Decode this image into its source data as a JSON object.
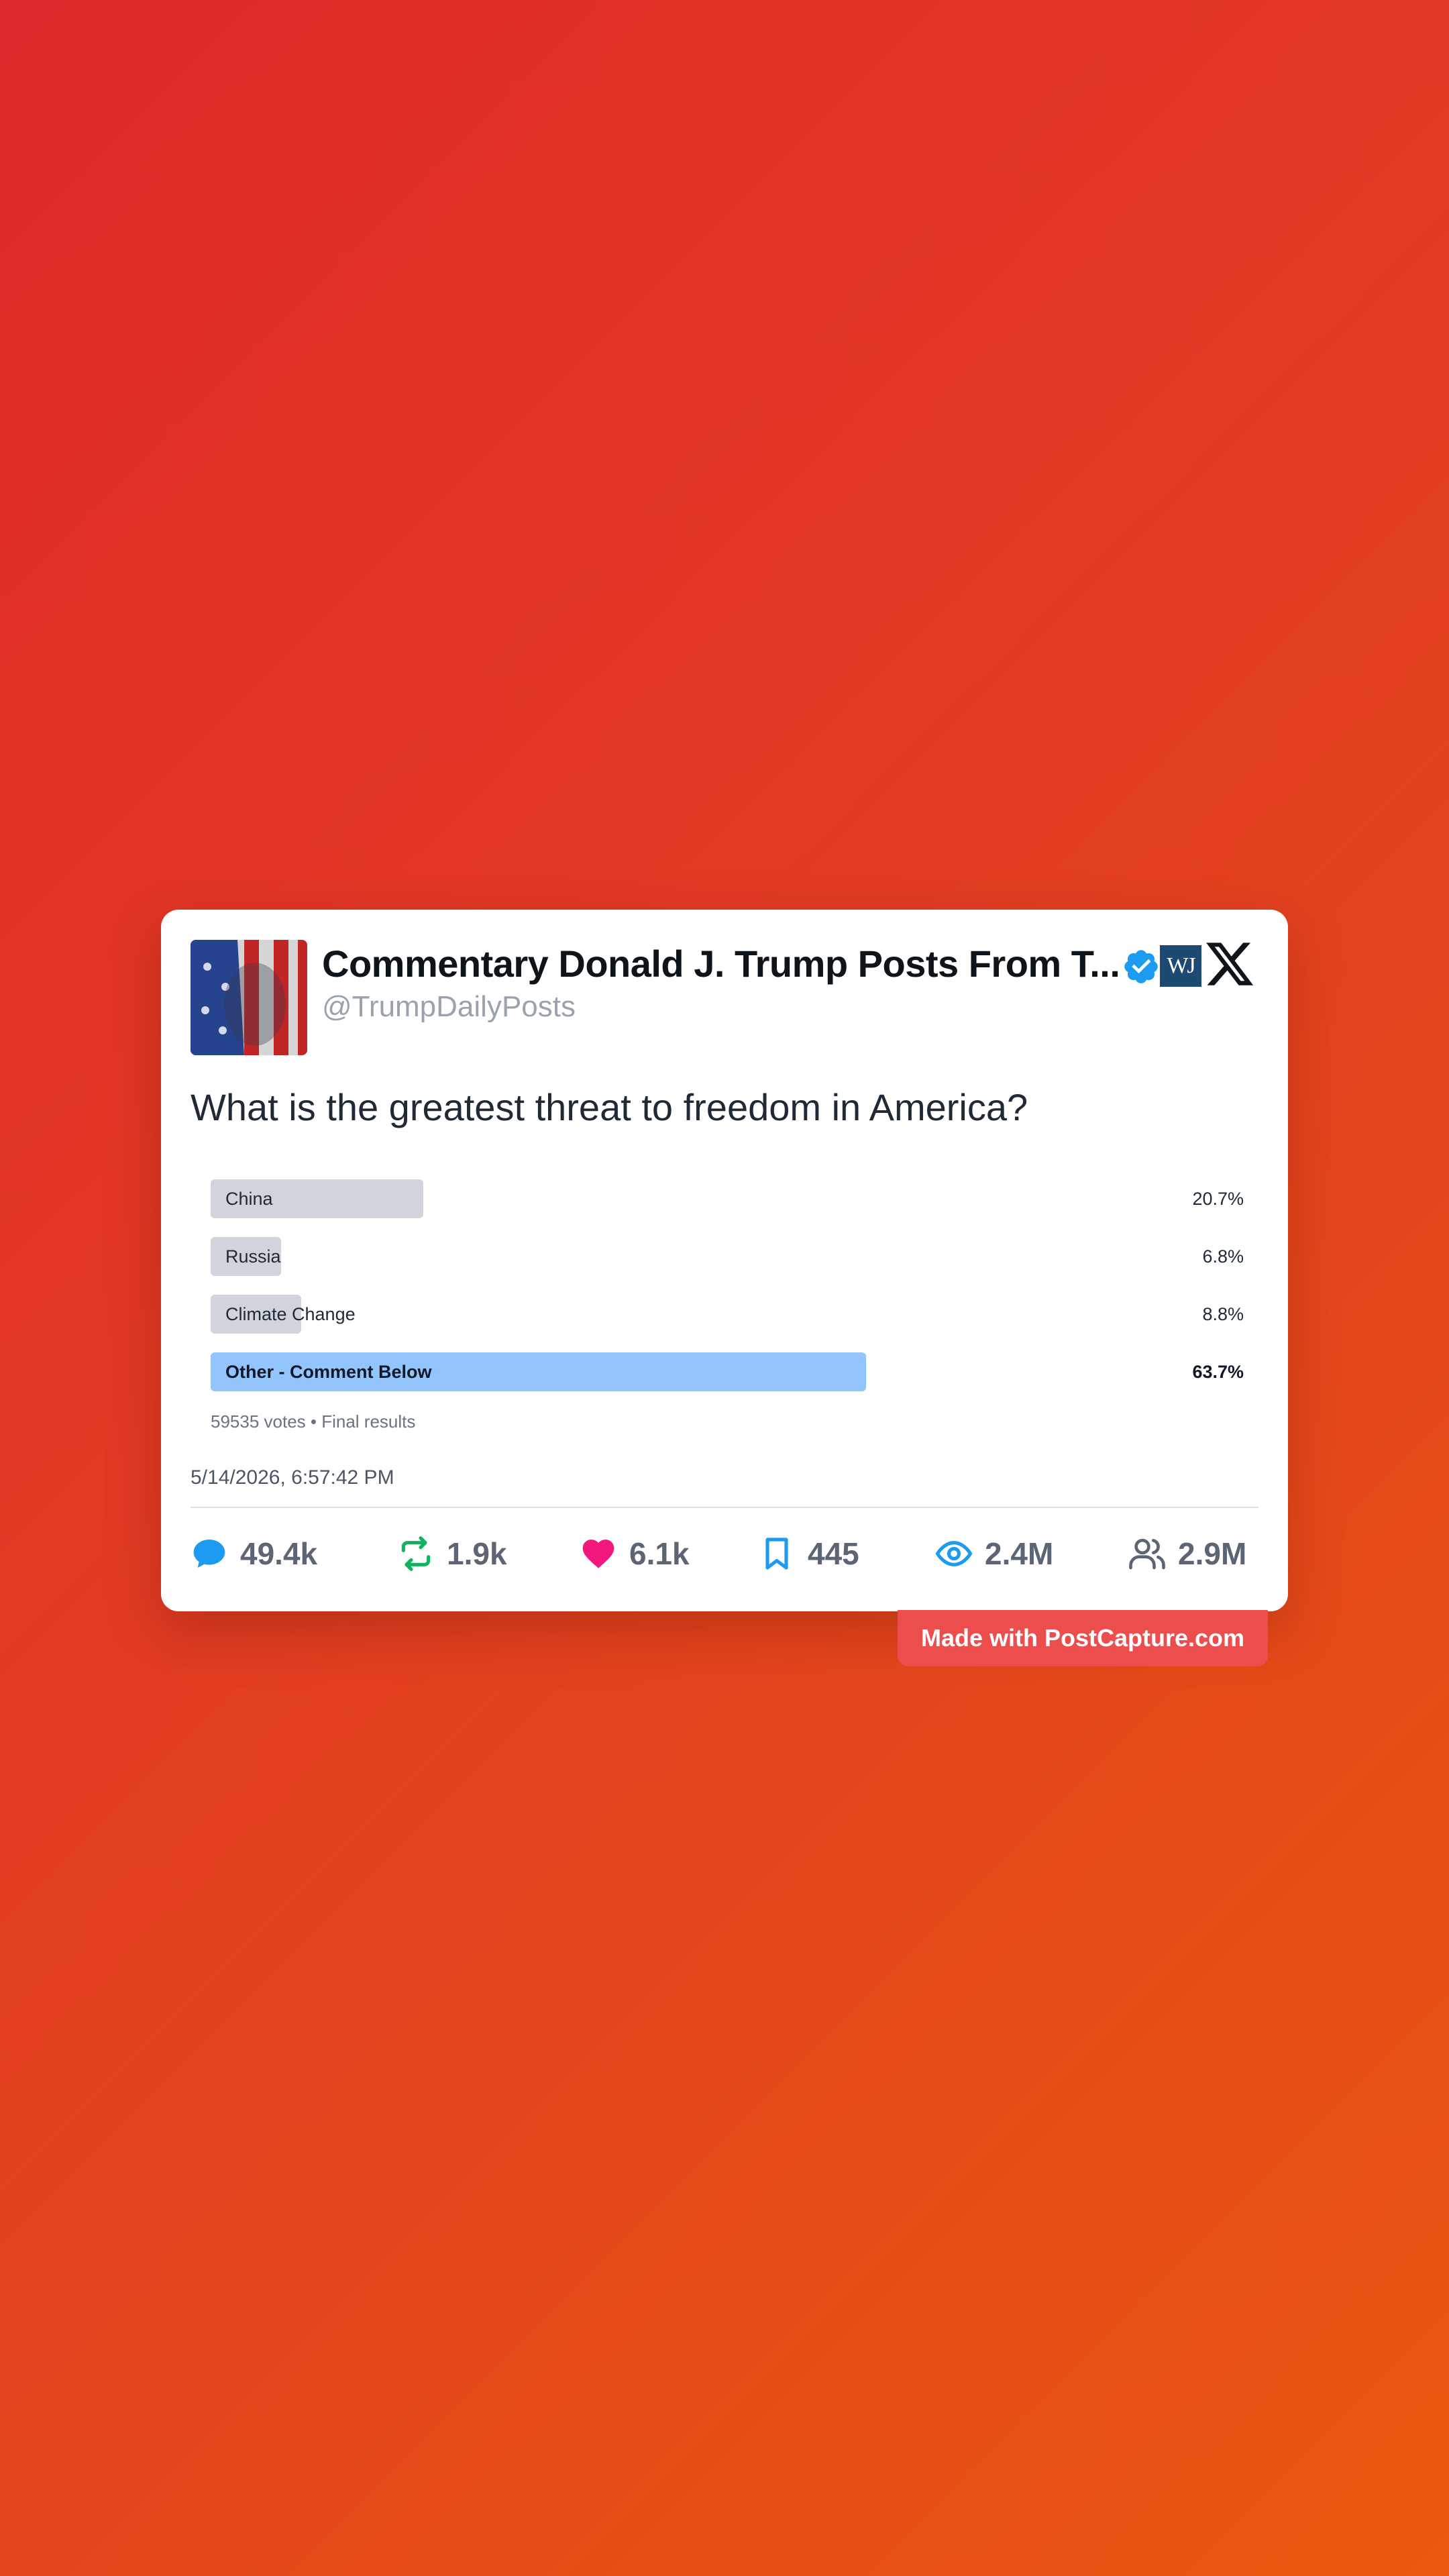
{
  "post": {
    "author_name": "Commentary Donald J. Trump Posts From T...",
    "handle": "@TrumpDailyPosts",
    "question": "What is the greatest threat to freedom in America?",
    "timestamp": "5/14/2026, 6:57:42 PM",
    "verified_color": "#1d9bf0"
  },
  "poll": {
    "options": [
      {
        "label": "China",
        "percent": "20.7%",
        "fraction": 0.207,
        "winner": false
      },
      {
        "label": "Russia",
        "percent": "6.8%",
        "fraction": 0.068,
        "winner": false
      },
      {
        "label": "Climate Change",
        "percent": "8.8%",
        "fraction": 0.088,
        "winner": false
      },
      {
        "label": "Other - Comment Below",
        "percent": "63.7%",
        "fraction": 0.637,
        "winner": true
      }
    ],
    "meta": "59535 votes • Final results"
  },
  "stats": {
    "replies": "49.4k",
    "reposts": "1.9k",
    "likes": "6.1k",
    "bookmarks": "445",
    "views": "2.4M",
    "followers": "2.9M"
  },
  "icons": {
    "replies": "speech-bubble-icon",
    "reposts": "repost-icon",
    "likes": "heart-icon",
    "bookmarks": "bookmark-icon",
    "views": "eye-icon",
    "followers": "users-icon",
    "platform": "x-logo",
    "publisher": "wj-logo"
  },
  "colors": {
    "reply": "#1d9bf0",
    "repost": "#10b45f",
    "like": "#f3187e",
    "bookmark": "#1d9bf0",
    "views": "#1d9bf0",
    "followers": "#5b6573",
    "winner_bar": "#93c5fd",
    "bar": "#d1d5db",
    "watermark": "#ec4e4e"
  },
  "watermark": {
    "text": "Made with PostCapture.com"
  }
}
